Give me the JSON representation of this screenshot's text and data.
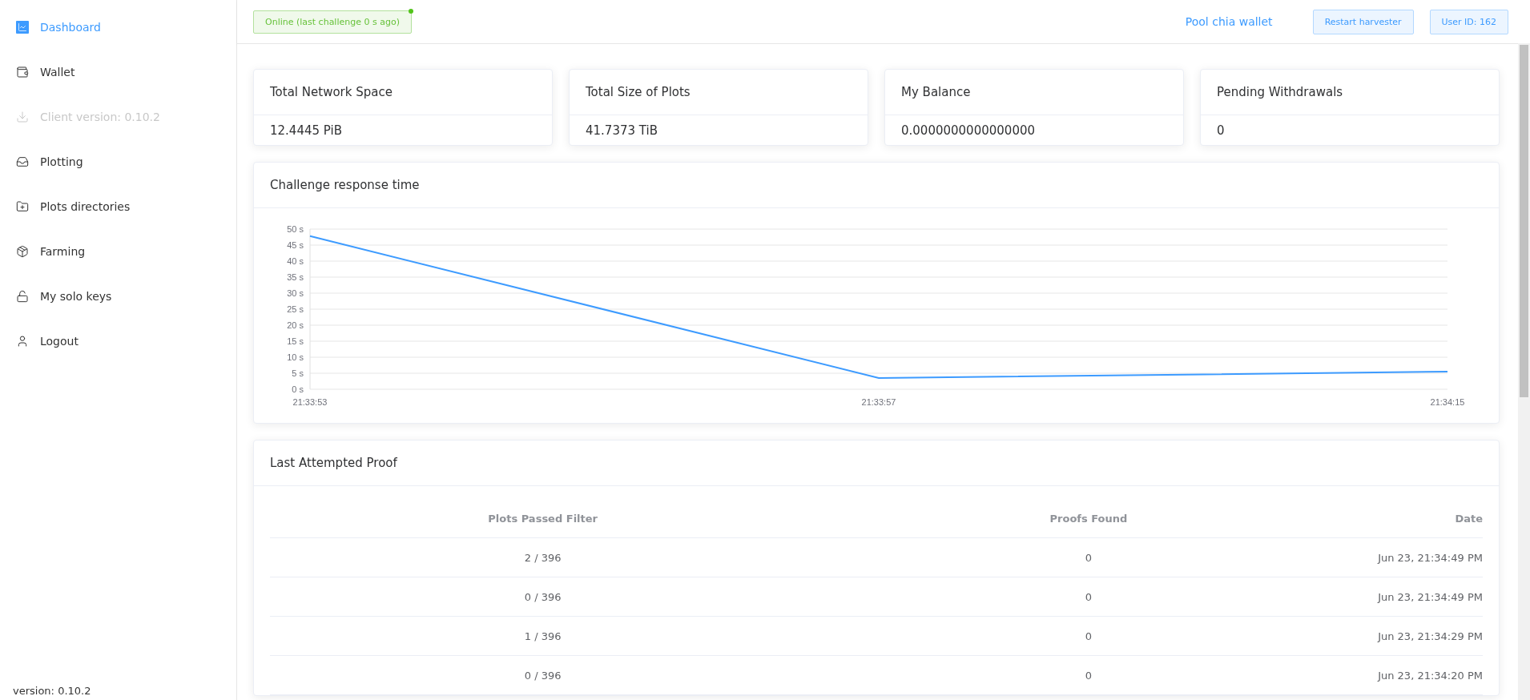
{
  "sidebar": {
    "items": [
      {
        "label": "Dashboard",
        "selected": true,
        "disabled": false
      },
      {
        "label": "Wallet",
        "selected": false,
        "disabled": false
      },
      {
        "label": "Client version: 0.10.2",
        "selected": false,
        "disabled": true
      },
      {
        "label": "Plotting",
        "selected": false,
        "disabled": false
      },
      {
        "label": "Plots directories",
        "selected": false,
        "disabled": false
      },
      {
        "label": "Farming",
        "selected": false,
        "disabled": false
      },
      {
        "label": "My solo keys",
        "selected": false,
        "disabled": false
      },
      {
        "label": "Logout",
        "selected": false,
        "disabled": false
      }
    ],
    "version": "version: 0.10.2"
  },
  "header": {
    "status": {
      "text": "Online (last challenge 0 s ago)",
      "online": true
    },
    "link": "Pool chia wallet",
    "buttons": [
      "Restart harvester",
      "User ID: 162"
    ]
  },
  "stats": [
    {
      "title": "Total Network Space",
      "value": "12.4445 PiB"
    },
    {
      "title": "Total Size of Plots",
      "value": "41.7373 TiB"
    },
    {
      "title": "My Balance",
      "value": "0.0000000000000000"
    },
    {
      "title": "Pending Withdrawals",
      "value": "0"
    }
  ],
  "response_chart": {
    "title": "Challenge response time",
    "chart_data": {
      "type": "line",
      "categories": [
        "21:33:53",
        "21:33:57",
        "21:34:15"
      ],
      "series": [
        {
          "color": "#3d9bff",
          "values": [
            47.8,
            3.5,
            5.5
          ]
        }
      ],
      "grid": true,
      "ylim": [
        0,
        50
      ],
      "yticks": [
        {
          "value": 0,
          "label": "0 s"
        },
        {
          "value": 5,
          "label": "5 s"
        },
        {
          "value": 10,
          "label": "10 s"
        },
        {
          "value": 15,
          "label": "15 s"
        },
        {
          "value": 20,
          "label": "20 s"
        },
        {
          "value": 25,
          "label": "25 s"
        },
        {
          "value": 30,
          "label": "30 s"
        },
        {
          "value": 35,
          "label": "35 s"
        },
        {
          "value": 40,
          "label": "40 s"
        },
        {
          "value": 45,
          "label": "45 s"
        },
        {
          "value": 50,
          "label": "50 s"
        }
      ]
    }
  },
  "proofs": {
    "title": "Last Attempted Proof",
    "columns": [
      "Plots Passed Filter",
      "Proofs Found",
      "Date"
    ],
    "rows": [
      [
        "2 / 396",
        "0",
        "Jun 23, 21:34:49 PM"
      ],
      [
        "0 / 396",
        "0",
        "Jun 23, 21:34:49 PM"
      ],
      [
        "1 / 396",
        "0",
        "Jun 23, 21:34:29 PM"
      ],
      [
        "0 / 396",
        "0",
        "Jun 23, 21:34:20 PM"
      ]
    ]
  }
}
